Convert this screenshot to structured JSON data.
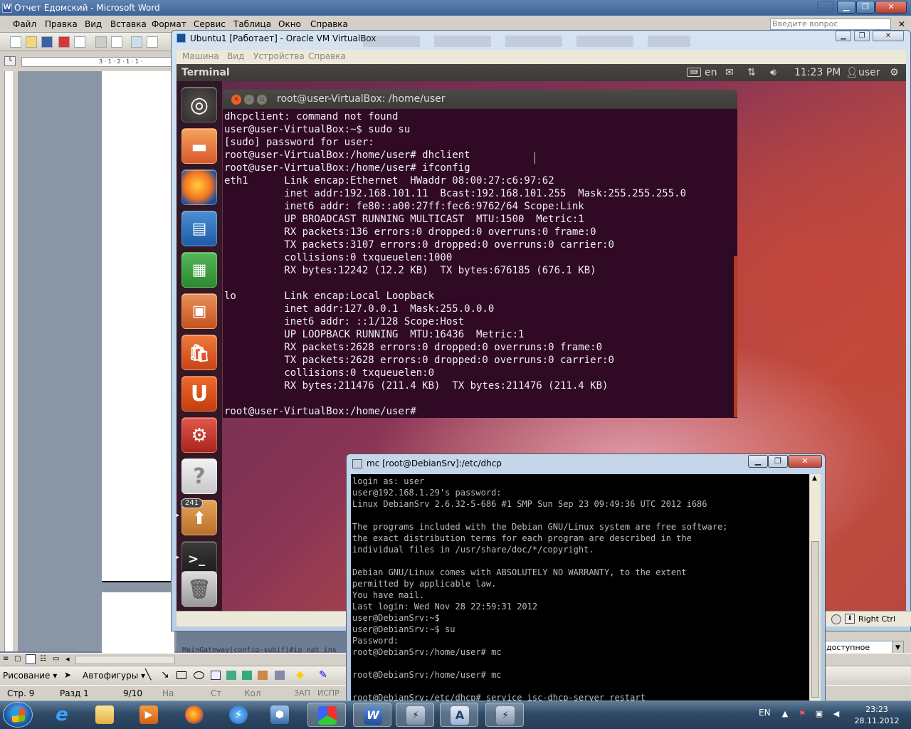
{
  "word": {
    "title": "Отчет Едомский - Microsoft Word",
    "menu": [
      "Файл",
      "Правка",
      "Вид",
      "Вставка",
      "Формат",
      "Сервис",
      "Таблица",
      "Окно",
      "Справка"
    ],
    "ask_placeholder": "Введите вопрос",
    "ruler_text": "3 · 1 · 2 · 1 · 1 ·",
    "doc_text": "MainGateway(config-subif)#ip nat ins",
    "drawing_label": "Рисование ▾",
    "autoshapes_label": "Автофигуры ▾",
    "status": {
      "page": "Стр. 9",
      "section": "Разд 1",
      "pages": "9/10",
      "at": "На",
      "line": "Ст",
      "col": "Кол",
      "rec": "ЗАП",
      "trk": "ИСПР"
    },
    "style_combo": "доступное"
  },
  "vbox": {
    "title": "Ubuntu1 [Работает] - Oracle VM VirtualBox",
    "menu": [
      "Машина",
      "Вид",
      "Устройства",
      "Справка"
    ],
    "host_key": "Right Ctrl"
  },
  "ubuntu": {
    "panel_app": "Terminal",
    "keyboard": "en",
    "time": "11:23 PM",
    "user": "user",
    "update_badge": "241"
  },
  "terminal": {
    "title": "root@user-VirtualBox: /home/user",
    "lines": [
      "dhcpclient: command not found",
      "user@user-VirtualBox:~$ sudo su",
      "[sudo] password for user:",
      "root@user-VirtualBox:/home/user# dhclient",
      "root@user-VirtualBox:/home/user# ifconfig",
      "eth1      Link encap:Ethernet  HWaddr 08:00:27:c6:97:62",
      "          inet addr:192.168.101.11  Bcast:192.168.101.255  Mask:255.255.255.0",
      "          inet6 addr: fe80::a00:27ff:fec6:9762/64 Scope:Link",
      "          UP BROADCAST RUNNING MULTICAST  MTU:1500  Metric:1",
      "          RX packets:136 errors:0 dropped:0 overruns:0 frame:0",
      "          TX packets:3107 errors:0 dropped:0 overruns:0 carrier:0",
      "          collisions:0 txqueuelen:1000",
      "          RX bytes:12242 (12.2 KB)  TX bytes:676185 (676.1 KB)",
      "",
      "lo        Link encap:Local Loopback",
      "          inet addr:127.0.0.1  Mask:255.0.0.0",
      "          inet6 addr: ::1/128 Scope:Host",
      "          UP LOOPBACK RUNNING  MTU:16436  Metric:1",
      "          RX packets:2628 errors:0 dropped:0 overruns:0 frame:0",
      "          TX packets:2628 errors:0 dropped:0 overruns:0 carrier:0",
      "          collisions:0 txqueuelen:0",
      "          RX bytes:211476 (211.4 KB)  TX bytes:211476 (211.4 KB)",
      "",
      "root@user-VirtualBox:/home/user#"
    ]
  },
  "putty": {
    "title": "mc [root@DebianSrv]:/etc/dhcp",
    "lines": [
      "login as: user",
      "user@192.168.1.29's password:",
      "Linux DebianSrv 2.6.32-5-686 #1 SMP Sun Sep 23 09:49:36 UTC 2012 i686",
      "",
      "The programs included with the Debian GNU/Linux system are free software;",
      "the exact distribution terms for each program are described in the",
      "individual files in /usr/share/doc/*/copyright.",
      "",
      "Debian GNU/Linux comes with ABSOLUTELY NO WARRANTY, to the extent",
      "permitted by applicable law.",
      "You have mail.",
      "Last login: Wed Nov 28 22:59:31 2012",
      "user@DebianSrv:~$",
      "user@DebianSrv:~$ su",
      "Password:",
      "root@DebianSrv:/home/user# mc",
      "",
      "root@DebianSrv:/home/user# mc",
      "",
      "root@DebianSrv:/etc/dhcp# service isc-dhcp-server restart"
    ]
  },
  "taskbar": {
    "lang": "EN",
    "time": "23:23",
    "date": "28.11.2012"
  }
}
